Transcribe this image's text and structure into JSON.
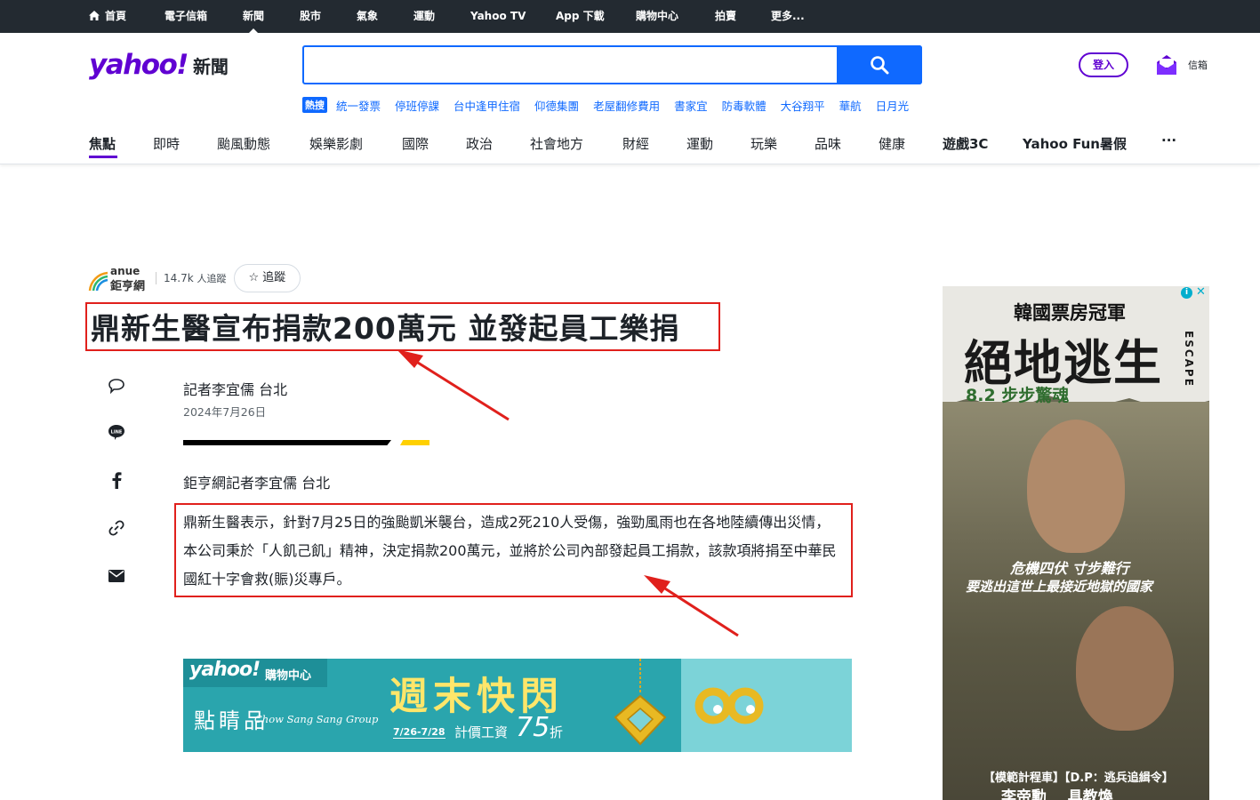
{
  "topbar": {
    "items": [
      "首頁",
      "電子信箱",
      "新聞",
      "股市",
      "氣象",
      "運動",
      "Yahoo TV",
      "App 下載",
      "購物中心",
      "拍賣",
      "更多..."
    ]
  },
  "logo": {
    "brand": "yahoo!",
    "section": "新聞"
  },
  "search": {
    "placeholder": "",
    "value": ""
  },
  "trending": {
    "tag": "熱搜",
    "keywords": [
      "統一發票",
      "停班停課",
      "台中逢甲住宿",
      "仰德集團",
      "老屋翻修費用",
      "書家宜",
      "防毒軟體",
      "大谷翔平",
      "華航",
      "日月光"
    ]
  },
  "account": {
    "login_label": "登入",
    "mail_label": "信箱"
  },
  "nav": {
    "items": [
      "焦點",
      "即時",
      "颱風動態",
      "娛樂影劇",
      "國際",
      "政治",
      "社會地方",
      "財經",
      "運動",
      "玩樂",
      "品味",
      "健康",
      "遊戲3C",
      "Yahoo Fun暑假",
      "..."
    ]
  },
  "article": {
    "publisher": {
      "name_en": "anue",
      "name_zh": "鉅亨網",
      "followers": "14.7k",
      "followers_label": "人追蹤",
      "follow_label": "追蹤"
    },
    "title": "鼎新生醫宣布捐款200萬元 並發起員工樂捐",
    "byline": "記者李宜儒 台北",
    "date": "2024年7月26日",
    "lead": "鉅亨網記者李宜儒 台北",
    "body": "鼎新生醫表示，針對7月25日的強颱凱米襲台，造成2死210人受傷，強勁風雨也在各地陸續傳出災情，本公司秉於「人飢己飢」精神，決定捐款200萬元，並將於公司內部發起員工捐款，該款項將捐至中華民國紅十字會救(賑)災專戶。"
  },
  "banner": {
    "brand": "yahoo!",
    "brand_suffix": "購物中心",
    "store_zh": "點睛品",
    "store_en": "Chow Sang Sang Group",
    "headline": "週末快閃",
    "dates": "7/26-7/28",
    "offer_prefix": "計價工資",
    "offer_number": "75",
    "offer_suffix": "折"
  },
  "side_ad": {
    "top": "韓國票房冠軍",
    "title": "絕地逃生",
    "title_en": "ESCAPE",
    "date": "8.2 步步驚魂",
    "tag1": "危機四伏 寸步難行",
    "tag2": "要逃出這世上最接近地獄的國家",
    "credits": "【模範計程車】【D.P：逃兵追緝令】",
    "names": "李帝勳    具教煥"
  },
  "colors": {
    "brand": "#6001d2",
    "search": "#0f69ff",
    "topbar": "#232a31",
    "annotation": "#e0201c"
  }
}
